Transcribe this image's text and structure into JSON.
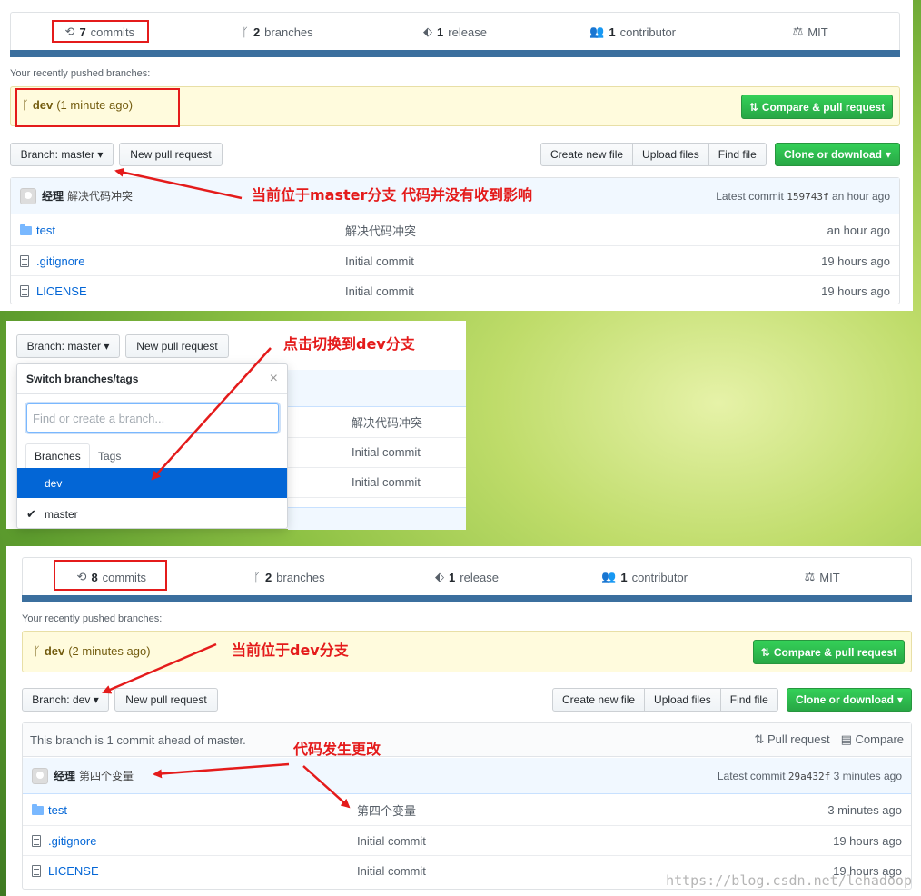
{
  "top": {
    "stats": {
      "commits": "7",
      "commits_label": "commits",
      "branches": "2",
      "branches_label": "branches",
      "releases": "1",
      "releases_label": "release",
      "contributors": "1",
      "contributors_label": "contributor",
      "license": "MIT"
    },
    "recent_label": "Your recently pushed branches:",
    "recent_branch": "dev",
    "recent_time": "(1 minute ago)",
    "compare_button": "Compare & pull request",
    "branch_prefix": "Branch:",
    "branch_name": "master",
    "new_pr": "New pull request",
    "create_file": "Create new file",
    "upload_files": "Upload files",
    "find_file": "Find file",
    "clone": "Clone or download",
    "commit_author": "经理",
    "commit_message": "解决代码冲突",
    "latest_commit": "Latest commit",
    "sha": "159743f",
    "commit_time": "an hour ago",
    "files": [
      {
        "name": "test",
        "type": "folder",
        "message": "解决代码冲突",
        "age": "an hour ago"
      },
      {
        "name": ".gitignore",
        "type": "file",
        "message": "Initial commit",
        "age": "19 hours ago"
      },
      {
        "name": "LICENSE",
        "type": "file",
        "message": "Initial commit",
        "age": "19 hours ago"
      }
    ],
    "annotation": "当前位于master分支  代码并没有收到影响"
  },
  "middle": {
    "branch_prefix": "Branch:",
    "branch_name": "master",
    "new_pr": "New pull request",
    "dropdown_title": "Switch branches/tags",
    "close": "×",
    "filter_placeholder": "Find or create a branch...",
    "tab_branches": "Branches",
    "tab_tags": "Tags",
    "branches": [
      "dev",
      "master"
    ],
    "checkmark": "✔",
    "behind_messages": [
      "解决代码冲突",
      "Initial commit",
      "Initial commit"
    ],
    "annotation": "点击切换到dev分支"
  },
  "bottom": {
    "stats": {
      "commits": "8",
      "commits_label": "commits",
      "branches": "2",
      "branches_label": "branches",
      "releases": "1",
      "releases_label": "release",
      "contributors": "1",
      "contributors_label": "contributor",
      "license": "MIT"
    },
    "recent_label": "Your recently pushed branches:",
    "recent_branch": "dev",
    "recent_time": "(2 minutes ago)",
    "compare_button": "Compare & pull request",
    "branch_prefix": "Branch:",
    "branch_name": "dev",
    "new_pr": "New pull request",
    "create_file": "Create new file",
    "upload_files": "Upload files",
    "find_file": "Find file",
    "clone": "Clone or download",
    "ahead_text": "This branch is 1 commit ahead of master.",
    "pull_request": "Pull request",
    "compare": "Compare",
    "commit_author": "经理",
    "commit_message": "第四个变量",
    "latest_commit": "Latest commit",
    "sha": "29a432f",
    "commit_time": "3 minutes ago",
    "files": [
      {
        "name": "test",
        "type": "folder",
        "message": "第四个变量",
        "age": "3 minutes ago"
      },
      {
        "name": ".gitignore",
        "type": "file",
        "message": "Initial commit",
        "age": "19 hours ago"
      },
      {
        "name": "LICENSE",
        "type": "file",
        "message": "Initial commit",
        "age": "19 hours ago"
      }
    ],
    "annotation_branch": "当前位于dev分支",
    "annotation_change": "代码发生更改"
  },
  "watermark": "https://blog.csdn.net/lehadoop",
  "colors": {
    "annotation": "#e41b1b",
    "green_button": "#2cbe4e",
    "summary_bar": "#3b6f9e"
  }
}
